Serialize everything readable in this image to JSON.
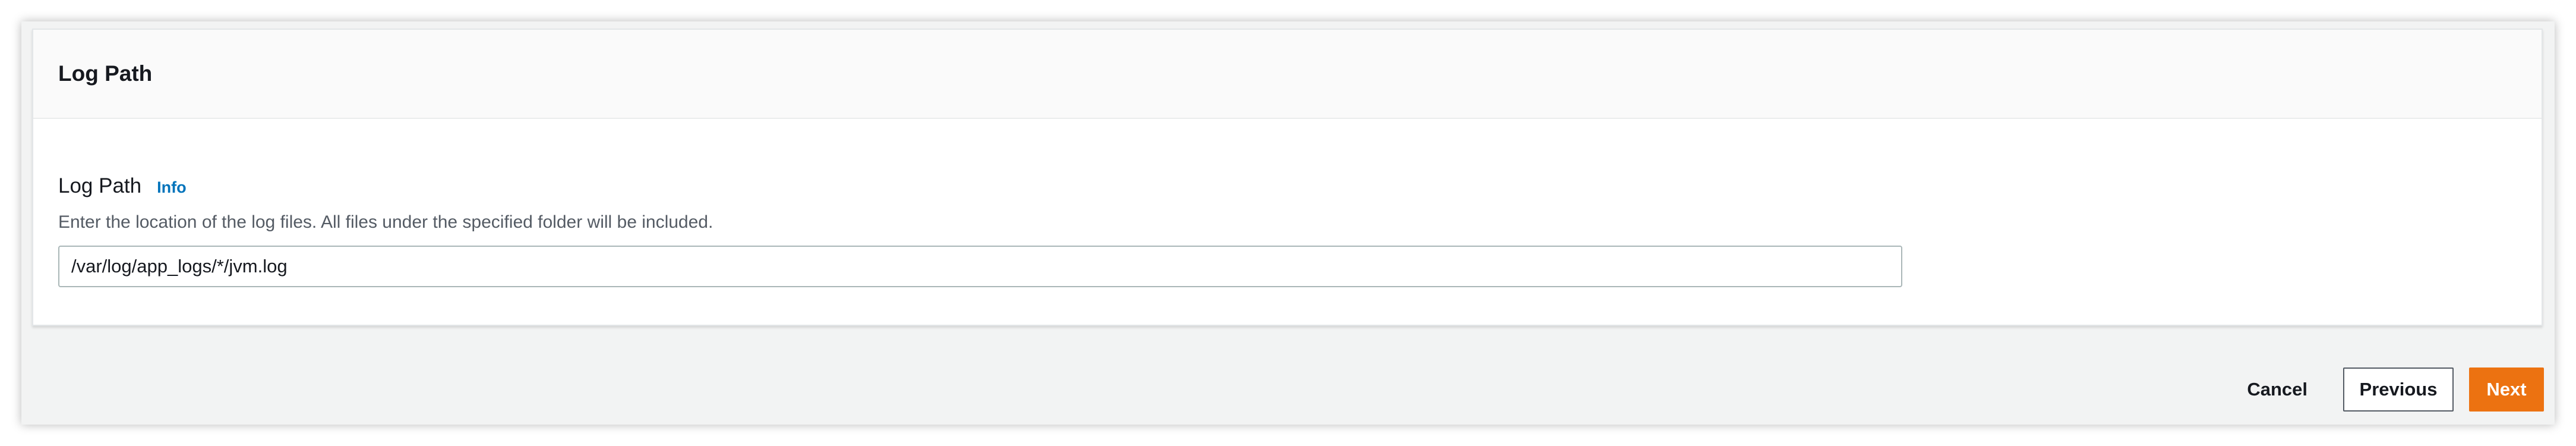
{
  "panel": {
    "title": "Log Path"
  },
  "field": {
    "label": "Log Path",
    "info_link": "Info",
    "description": "Enter the location of the log files. All files under the specified folder will be included.",
    "value": "/var/log/app_logs/*/jvm.log"
  },
  "actions": {
    "cancel_label": "Cancel",
    "previous_label": "Previous",
    "next_label": "Next"
  },
  "colors": {
    "primary_button": "#ec7211",
    "link": "#0073bb",
    "page_background": "#f2f3f3"
  }
}
